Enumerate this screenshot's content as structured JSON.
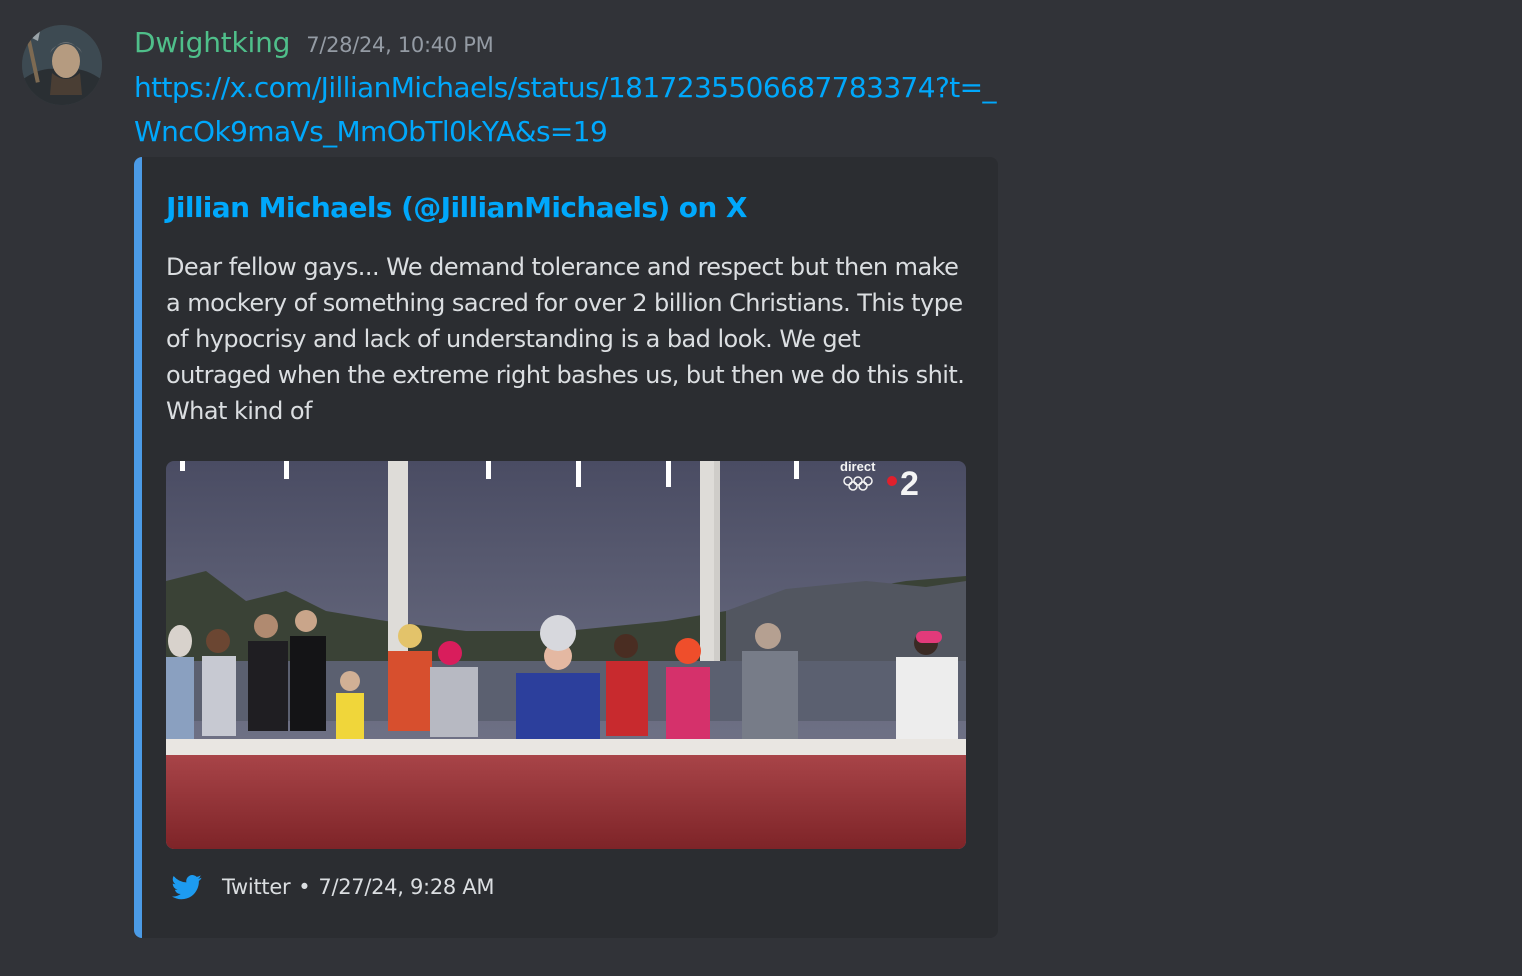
{
  "message": {
    "author": "Dwightking",
    "timestamp": "7/28/24, 10:40 PM",
    "link_text": "https://x.com/JillianMichaels/status/1817235506687783374?t=_WncOk9maVs_MmObTl0kYA&s=19",
    "colors": {
      "background": "#313338",
      "username": "#4fbf8a",
      "link": "#00a8fc",
      "embed_background": "#2b2d31",
      "embed_accent": "#4b9be6"
    }
  },
  "embed": {
    "title": "Jillian Michaels (@JillianMichaels) on X",
    "description": "Dear fellow gays... We demand tolerance and respect but then make a mockery of something sacred for over 2 billion Christians. This type of hypocrisy and lack of understanding is a bad look. We get outraged when the extreme right bashes us, but then we do this shit. What kind of",
    "image": {
      "overlay_text": "direct",
      "channel_logo": "2"
    },
    "footer": {
      "icon": "twitter-bird-icon",
      "provider": "Twitter",
      "separator": "•",
      "timestamp": "7/27/24, 9:28 AM"
    }
  }
}
